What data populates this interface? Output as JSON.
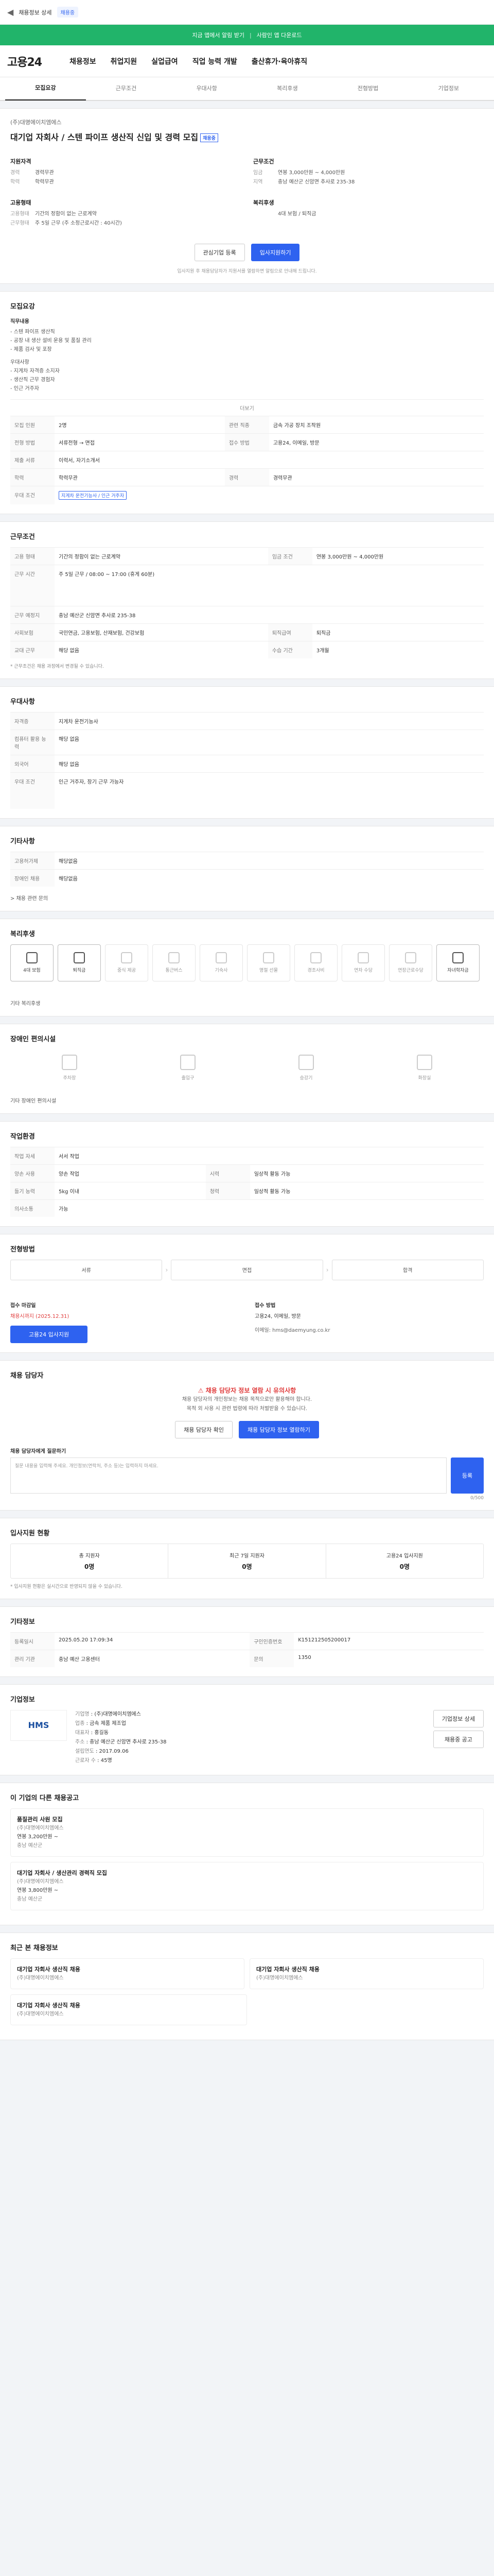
{
  "topbar": {
    "back": "◀",
    "title": "채용정보 상세",
    "chip": "채용중",
    "menu": "≡"
  },
  "banner": {
    "left": "지금 앱에서 알림 받기",
    "right": "사람인 앱 다운로드"
  },
  "gnb": {
    "logo": "고용24",
    "nav": [
      "채용정보",
      "취업지원",
      "실업급여",
      "직업 능력 개발",
      "출산휴가·육아휴직"
    ]
  },
  "tabs": [
    "모집요강",
    "근무조건",
    "우대사항",
    "복리후생",
    "전형방법",
    "기업정보"
  ],
  "header": {
    "company": "(주)대명에이치엠에스",
    "title": "대기업 자회사 / 스텐 파이프 생산직 신입 및 경력 모집",
    "badge": "채용중",
    "left_heading": "지원자격",
    "left_rows": [
      {
        "k": "경력",
        "v": "경력무관"
      },
      {
        "k": "학력",
        "v": "학력무관"
      }
    ],
    "left_heading2": "고용형태",
    "left_rows2": [
      {
        "k": "고용형태",
        "v": "기간의 정함이 없는 근로계약"
      },
      {
        "k": "근무형태",
        "v": "주 5일 근무 (주 소정근로시간 : 40시간)"
      }
    ],
    "right_heading": "근무조건",
    "right_rows": [
      {
        "k": "임금",
        "v": "연봉 3,000만원 ~ 4,000만원"
      },
      {
        "k": "지역",
        "v": "충남 예산군 신암면 추사로 235-38"
      }
    ],
    "right_heading2": "복리후생",
    "right_rows2": [
      {
        "k": "",
        "v": "4대 보험 / 퇴직금"
      }
    ]
  },
  "actions": {
    "save": "관심기업 등록",
    "apply": "입사지원하기",
    "note": "입사지원 후 채용담당자가 지원서를 열람하면 알림으로 안내해 드립니다."
  },
  "recruit": {
    "title": "모집요강",
    "job_heading": "직무내용",
    "job_lines": [
      "- 스텐 파이프 생산직",
      "- 공장 내 생산 설비 운용 및 품질 관리",
      "- 제품 검사 및 포장",
      "우대사항",
      "- 지게차 자격증 소지자",
      "- 생산직 근무 경험자",
      "- 인근 거주자"
    ],
    "more": "더보기",
    "rows": [
      {
        "k": "모집 인원",
        "v": "2명"
      },
      {
        "k": "관련 직종",
        "v": "금속 가공 장치 조작원"
      },
      {
        "k": "전형 방법",
        "v": "서류전형 → 면접"
      },
      {
        "k": "접수 방법",
        "v": "고용24, 이메일, 방문"
      },
      {
        "k": "제출 서류",
        "v": "이력서, 자기소개서"
      },
      {
        "k": "학력",
        "v": "학력무관"
      },
      {
        "k": "경력",
        "v": "경력무관"
      },
      {
        "k": "우대 조건",
        "v": "지게차 운전기능사 / 인근 거주자"
      }
    ]
  },
  "work": {
    "title": "근무조건",
    "rows": [
      {
        "k": "고용 형태",
        "v": "기간의 정함이 없는 근로계약"
      },
      {
        "k": "임금 조건",
        "v": "연봉 3,000만원 ~ 4,000만원"
      },
      {
        "k": "근무 시간",
        "v": "주 5일 근무 / 08:00 ~ 17:00 (휴게 60분)"
      },
      {
        "k": "근무 예정지",
        "v": "충남 예산군 신암면 추사로 235-38"
      },
      {
        "k": "사회보험",
        "v": "국민연금, 고용보험, 산재보험, 건강보험"
      },
      {
        "k": "퇴직급여",
        "v": "퇴직금"
      },
      {
        "k": "교대 근무",
        "v": "해당 없음"
      },
      {
        "k": "수습 기간",
        "v": "3개월"
      }
    ],
    "note": "* 근무조건은 채용 과정에서 변경될 수 있습니다."
  },
  "prefer": {
    "title": "우대사항",
    "rows": [
      {
        "k": "자격증",
        "v": "지게차 운전기능사"
      },
      {
        "k": "컴퓨터 활용 능력",
        "v": "해당 없음"
      },
      {
        "k": "외국어",
        "v": "해당 없음"
      },
      {
        "k": "우대 조건",
        "v": "인근 거주자, 장기 근무 가능자"
      }
    ]
  },
  "etc": {
    "title": "기타사항",
    "rows": [
      {
        "k": "고용허가제",
        "v": "해당없음"
      },
      {
        "k": "장애인 채용",
        "v": "해당없음"
      }
    ],
    "link": "> 채용 관련 문의"
  },
  "benefits": {
    "title": "복리후생",
    "items": [
      "4대 보험",
      "퇴직금",
      "중식 제공",
      "통근버스",
      "기숙사",
      "명절 선물",
      "경조사비",
      "연차 수당",
      "연장근로수당",
      "자녀학자금"
    ],
    "note": "기타 복리후생"
  },
  "disabled": {
    "title": "장애인 편의시설",
    "items": [
      "주차장",
      "출입구",
      "승강기",
      "화장실"
    ],
    "note": "기타 장애인 편의시설"
  },
  "workenv": {
    "title": "작업환경",
    "rows": [
      {
        "k": "작업 자세",
        "v": "서서 작업"
      },
      {
        "k": "양손 사용",
        "v": "양손 작업"
      },
      {
        "k": "들기 능력",
        "v": "5kg 이내"
      },
      {
        "k": "시력",
        "v": "일상적 활동 가능"
      },
      {
        "k": "청력",
        "v": "일상적 활동 가능"
      },
      {
        "k": "의사소통",
        "v": "가능"
      }
    ]
  },
  "selection": {
    "title": "전형방법",
    "steps": [
      "서류",
      "면접",
      "합격"
    ],
    "deadline_label": "접수 마감일",
    "deadline": "채용시까지 (2025.12.31)",
    "method_label": "접수 방법",
    "method": "고용24, 이메일, 방문",
    "apply_btn": "고용24 입사지원",
    "contact": "이메일: hms@daemyung.co.kr"
  },
  "contact": {
    "title": "채용 담당자",
    "warn": "채용 담당자 정보 열람 시 유의사항",
    "lines": [
      "채용 담당자의 개인정보는 채용 목적으로만 활용해야 합니다.",
      "목적 외 사용 시 관련 법령에 따라 처벌받을 수 있습니다."
    ],
    "btn1": "채용 담당자 확인",
    "btn2": "채용 담당자 정보 열람하기",
    "textarea_label": "채용 담당자에게 질문하기",
    "placeholder": "질문 내용을 입력해 주세요. 개인정보(연락처, 주소 등)는 입력하지 마세요.",
    "counter": "0/500",
    "submit": "등록"
  },
  "apply_status": {
    "title": "입사지원 현황",
    "cells": [
      {
        "label": "총 지원자",
        "n": "0명"
      },
      {
        "label": "최근 7일 지원자",
        "n": "0명"
      },
      {
        "label": "고용24 입사지원",
        "n": "0명"
      }
    ],
    "note": "* 입사지원 현황은 실시간으로 반영되지 않을 수 있습니다."
  },
  "regist": {
    "title": "기타정보",
    "rows": [
      {
        "k": "등록일시",
        "v": "2025.05.20 17:09:34"
      },
      {
        "k": "구인인증번호",
        "v": "K151212505200017"
      },
      {
        "k": "관리 기관",
        "v": "충남 예산 고용센터"
      },
      {
        "k": "문의",
        "v": "1350"
      }
    ]
  },
  "company": {
    "title": "기업정보",
    "logo_text": "HMS",
    "rows": [
      {
        "k": "기업명",
        "v": "(주)대명에이치엠에스"
      },
      {
        "k": "업종",
        "v": "금속 제품 제조업"
      },
      {
        "k": "대표자",
        "v": "홍길동"
      },
      {
        "k": "주소",
        "v": "충남 예산군 신암면 추사로 235-38"
      },
      {
        "k": "설립연도",
        "v": "2017.09.06"
      },
      {
        "k": "근로자 수",
        "v": "45명"
      }
    ],
    "btn1": "기업정보 상세",
    "btn2": "채용중 공고"
  },
  "others": {
    "title": "이 기업의 다른 채용공고",
    "items": [
      {
        "ttl": "품질관리 사원 모집",
        "co": "(주)대명에이치엠에스",
        "pay": "연봉 3,200만원 ~",
        "loc": "충남 예산군"
      },
      {
        "ttl": "대기업 자회사 / 생산관리 경력직 모집",
        "co": "(주)대명에이치엠에스",
        "pay": "연봉 3,800만원 ~",
        "loc": "충남 예산군"
      }
    ]
  },
  "recent": {
    "title": "최근 본 채용정보",
    "items": [
      {
        "ttl": "대기업 자회사 생산직 채용",
        "co": "(주)대명에이치엠에스"
      },
      {
        "ttl": "대기업 자회사 생산직 채용",
        "co": "(주)대명에이치엠에스"
      },
      {
        "ttl": "대기업 자회사 생산직 채용",
        "co": "(주)대명에이치엠에스"
      }
    ]
  }
}
